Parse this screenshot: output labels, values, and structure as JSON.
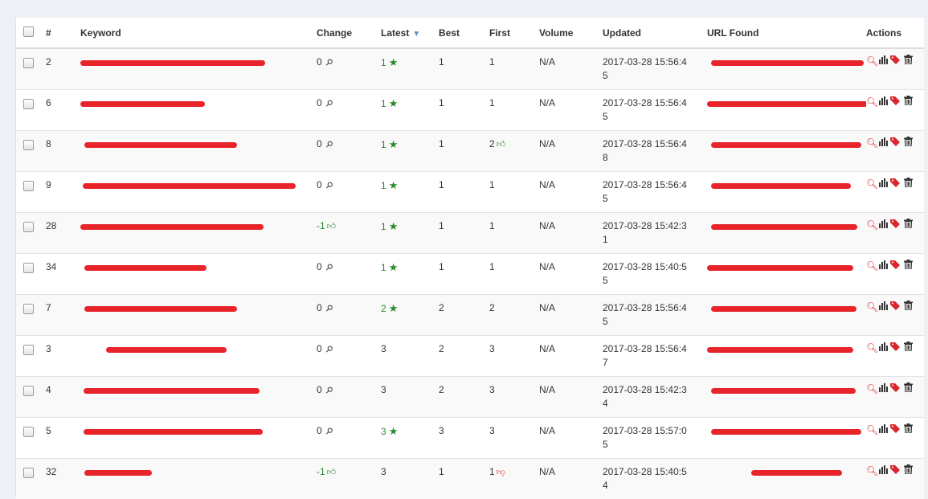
{
  "header": {
    "num": "#",
    "keyword": "Keyword",
    "change": "Change",
    "latest": "Latest",
    "best": "Best",
    "first": "First",
    "volume": "Volume",
    "updated": "Updated",
    "url_found": "URL Found",
    "actions": "Actions"
  },
  "sort": {
    "column": "latest",
    "direction": "descending",
    "icon": "sort-down-icon"
  },
  "colors": {
    "redaction": "#e8232a",
    "positive": "#2a8a2a",
    "negative": "#d9262c",
    "sort_icon": "#5d8fcf"
  },
  "rows": [
    {
      "num": "2",
      "change": "0",
      "change_icon": "pin-icon",
      "latest": "1",
      "latest_star": true,
      "best": "1",
      "first": "1",
      "first_icon": "",
      "volume": "N/A",
      "updated": "2017-03-28 15:56:45"
    },
    {
      "num": "6",
      "change": "0",
      "change_icon": "pin-icon",
      "latest": "1",
      "latest_star": true,
      "best": "1",
      "first": "1",
      "first_icon": "",
      "volume": "N/A",
      "updated": "2017-03-28 15:56:45"
    },
    {
      "num": "8",
      "change": "0",
      "change_icon": "pin-icon",
      "latest": "1",
      "latest_star": true,
      "best": "1",
      "first": "2",
      "first_icon": "thumbs-up-icon",
      "volume": "N/A",
      "updated": "2017-03-28 15:56:48"
    },
    {
      "num": "9",
      "change": "0",
      "change_icon": "pin-icon",
      "latest": "1",
      "latest_star": true,
      "best": "1",
      "first": "1",
      "first_icon": "",
      "volume": "N/A",
      "updated": "2017-03-28 15:56:45"
    },
    {
      "num": "28",
      "change": "-1",
      "change_icon": "thumbs-up-icon",
      "latest": "1",
      "latest_star": true,
      "best": "1",
      "first": "1",
      "first_icon": "",
      "volume": "N/A",
      "updated": "2017-03-28 15:42:31"
    },
    {
      "num": "34",
      "change": "0",
      "change_icon": "pin-icon",
      "latest": "1",
      "latest_star": true,
      "best": "1",
      "first": "1",
      "first_icon": "",
      "volume": "N/A",
      "updated": "2017-03-28 15:40:55"
    },
    {
      "num": "7",
      "change": "0",
      "change_icon": "pin-icon",
      "latest": "2",
      "latest_star": true,
      "best": "2",
      "first": "2",
      "first_icon": "",
      "volume": "N/A",
      "updated": "2017-03-28 15:56:45"
    },
    {
      "num": "3",
      "change": "0",
      "change_icon": "pin-icon",
      "latest": "3",
      "latest_star": false,
      "best": "2",
      "first": "3",
      "first_icon": "",
      "volume": "N/A",
      "updated": "2017-03-28 15:56:47"
    },
    {
      "num": "4",
      "change": "0",
      "change_icon": "pin-icon",
      "latest": "3",
      "latest_star": false,
      "best": "2",
      "first": "3",
      "first_icon": "",
      "volume": "N/A",
      "updated": "2017-03-28 15:42:34"
    },
    {
      "num": "5",
      "change": "0",
      "change_icon": "pin-icon",
      "latest": "3",
      "latest_star": true,
      "best": "3",
      "first": "3",
      "first_icon": "",
      "volume": "N/A",
      "updated": "2017-03-28 15:57:05"
    },
    {
      "num": "32",
      "change": "-1",
      "change_icon": "thumbs-up-icon",
      "latest": "3",
      "latest_star": false,
      "best": "1",
      "first": "1",
      "first_icon": "thumbs-down-icon",
      "volume": "N/A",
      "updated": "2017-03-28 15:40:54"
    }
  ],
  "row_actions": [
    "search-icon",
    "bar-chart-icon",
    "tag-icon",
    "trash-icon"
  ]
}
